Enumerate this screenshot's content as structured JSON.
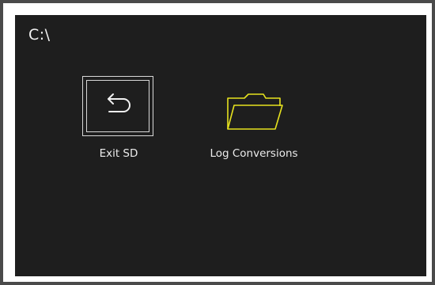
{
  "header": {
    "path": "C:\\"
  },
  "items": [
    {
      "label": "Exit SD",
      "icon": "back-arrow-icon"
    },
    {
      "label": "Log Conversions",
      "icon": "folder-icon"
    }
  ],
  "colors": {
    "background": "#1e1e1e",
    "frame": "#4a4a4a",
    "text": "#ececec",
    "folder_outline": "#e6e21e",
    "icon_outline": "#d8d8d8"
  }
}
